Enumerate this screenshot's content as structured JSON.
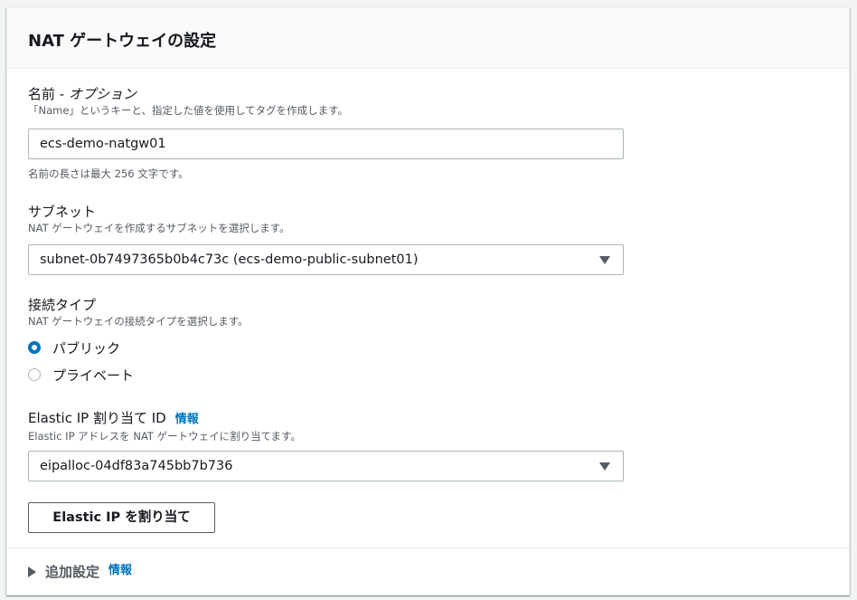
{
  "panel": {
    "title": "NAT ゲートウェイの設定"
  },
  "name_field": {
    "label": "名前 - ",
    "label_optional": "オプション",
    "description": "「Name」というキーと、指定した値を使用してタグを作成します。",
    "value": "ecs-demo-natgw01",
    "constraint": "名前の長さは最大 256 文字です。"
  },
  "subnet_field": {
    "label": "サブネット",
    "description": "NAT ゲートウェイを作成するサブネットを選択します。",
    "selected": "subnet-0b7497365b0b4c73c (ecs-demo-public-subnet01)"
  },
  "connectivity_field": {
    "label": "接続タイプ",
    "description": "NAT ゲートウェイの接続タイプを選択します。",
    "options": [
      {
        "label": "パブリック",
        "selected": true
      },
      {
        "label": "プライベート",
        "selected": false
      }
    ]
  },
  "eip_field": {
    "label": "Elastic IP 割り当て ID",
    "info": "情報",
    "description": "Elastic IP アドレスを NAT ゲートウェイに割り当てます。",
    "selected": "eipalloc-04df83a745bb7b736",
    "allocate_button": "Elastic IP を割り当て"
  },
  "additional": {
    "label": "追加設定",
    "info": "情報"
  },
  "colors": {
    "accent": "#0073bb",
    "text": "#16191f",
    "secondary_text": "#545b64",
    "border": "#aab7b8"
  },
  "icons": {
    "select_caret": "caret-down-icon",
    "expand": "caret-right-icon"
  }
}
